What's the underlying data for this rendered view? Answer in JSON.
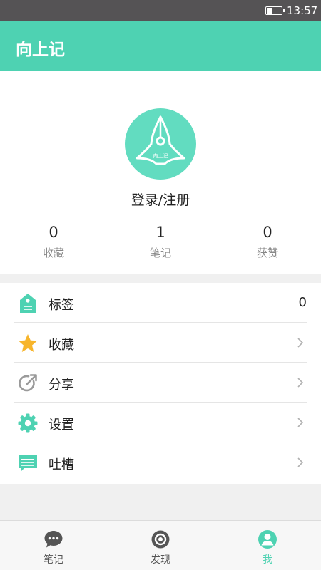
{
  "status_bar": {
    "time": "13:57",
    "battery_level": 0.4
  },
  "app_bar": {
    "title": "向上记"
  },
  "profile": {
    "avatar_text": "向上记",
    "login_label": "登录/注册",
    "stats": [
      {
        "value": "0",
        "label": "收藏"
      },
      {
        "value": "1",
        "label": "笔记"
      },
      {
        "value": "0",
        "label": "获赞"
      }
    ]
  },
  "menu": {
    "items": [
      {
        "label": "标签",
        "value": "0",
        "icon": "tag-icon"
      },
      {
        "label": "收藏",
        "icon": "star-icon"
      },
      {
        "label": "分享",
        "icon": "share-icon"
      },
      {
        "label": "设置",
        "icon": "gear-icon"
      },
      {
        "label": "吐槽",
        "icon": "feedback-icon"
      }
    ]
  },
  "tab_bar": {
    "tabs": [
      {
        "label": "笔记",
        "icon": "chat-bubble-icon"
      },
      {
        "label": "发现",
        "icon": "camera-lens-icon"
      },
      {
        "label": "我",
        "icon": "person-icon",
        "active": true
      }
    ]
  },
  "colors": {
    "accent": "#4ed2b2",
    "status_bar": "#555355",
    "star": "#f7b52c",
    "muted_icon": "#9a9a9a"
  }
}
